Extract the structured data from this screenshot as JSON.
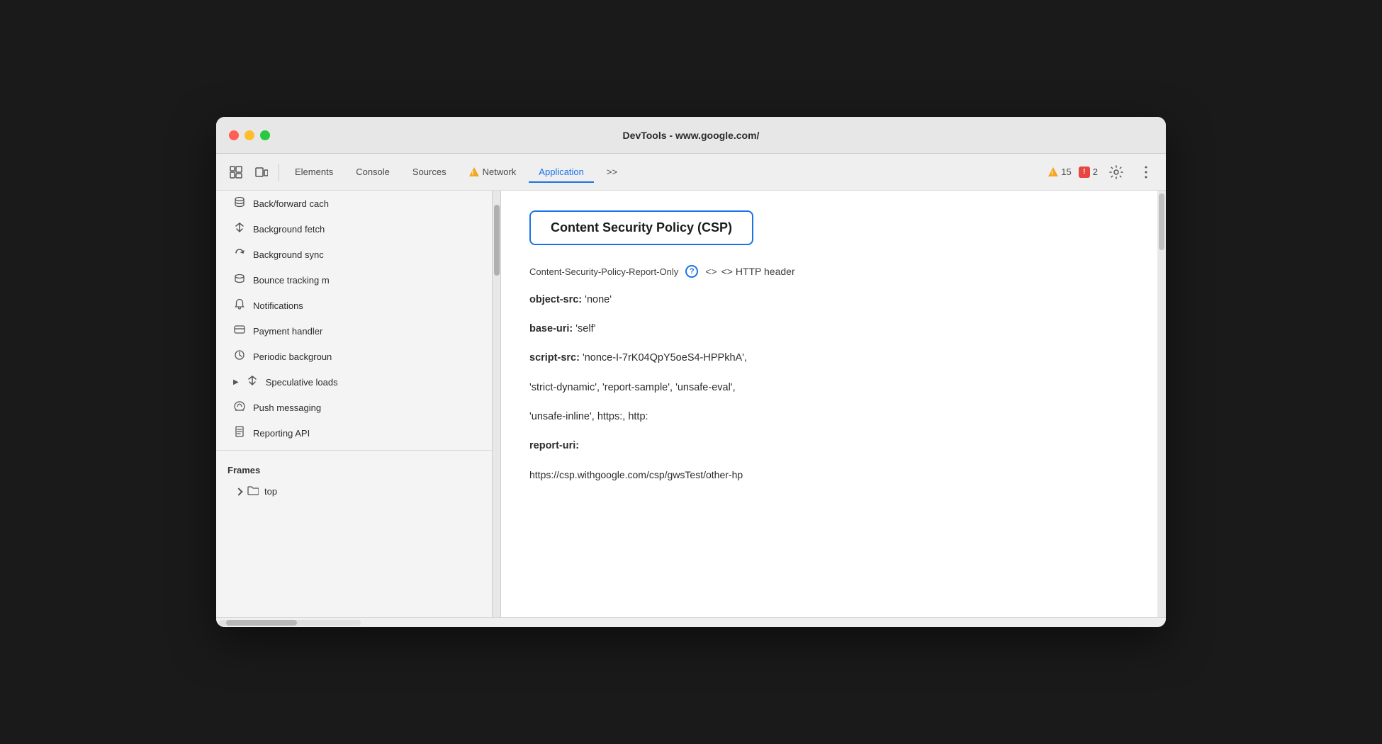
{
  "window": {
    "title": "DevTools - www.google.com/"
  },
  "toolbar": {
    "tabs": [
      {
        "id": "elements",
        "label": "Elements",
        "active": false
      },
      {
        "id": "console",
        "label": "Console",
        "active": false
      },
      {
        "id": "sources",
        "label": "Sources",
        "active": false
      },
      {
        "id": "network",
        "label": "Network",
        "active": false,
        "warning": true
      },
      {
        "id": "application",
        "label": "Application",
        "active": true
      }
    ],
    "more_tabs_label": ">>",
    "warnings_count": "15",
    "errors_count": "2"
  },
  "sidebar": {
    "items": [
      {
        "id": "back-forward-cache",
        "label": "Back/forward cach",
        "icon": "🗄"
      },
      {
        "id": "background-fetch",
        "label": "Background fetch",
        "icon": "⇅"
      },
      {
        "id": "background-sync",
        "label": "Background sync",
        "icon": "↺"
      },
      {
        "id": "bounce-tracking",
        "label": "Bounce tracking m",
        "icon": "🗄"
      },
      {
        "id": "notifications",
        "label": "Notifications",
        "icon": "🔔"
      },
      {
        "id": "payment-handler",
        "label": "Payment handler",
        "icon": "💳"
      },
      {
        "id": "periodic-background",
        "label": "Periodic backgroun",
        "icon": "⏱"
      },
      {
        "id": "speculative-loads",
        "label": "Speculative loads",
        "icon": "⇅",
        "has_arrow": true
      },
      {
        "id": "push-messaging",
        "label": "Push messaging",
        "icon": "☁"
      },
      {
        "id": "reporting-api",
        "label": "Reporting API",
        "icon": "📄"
      }
    ],
    "frames_section": {
      "header": "Frames",
      "items": [
        {
          "id": "top",
          "label": "top",
          "icon": "🗂"
        }
      ]
    }
  },
  "main": {
    "csp_title": "Content Security Policy (CSP)",
    "source_label": "Content-Security-Policy-Report-Only",
    "http_header_label": "<> HTTP header",
    "directives": [
      {
        "id": "object-src",
        "key": "object-src:",
        "value": " 'none'"
      },
      {
        "id": "base-uri",
        "key": "base-uri:",
        "value": " 'self'"
      },
      {
        "id": "script-src",
        "key": "script-src:",
        "value": " 'nonce-I-7rK04QpY5oeS4-HPPkhA',"
      },
      {
        "id": "script-src-cont",
        "key": "",
        "value": "'strict-dynamic', 'report-sample', 'unsafe-eval',"
      },
      {
        "id": "script-src-cont2",
        "key": "",
        "value": "'unsafe-inline', https:, http:"
      },
      {
        "id": "report-uri",
        "key": "report-uri:",
        "value": ""
      },
      {
        "id": "report-uri-url",
        "key": "",
        "value": "https://csp.withgoogle.com/csp/gwsTest/other-hp"
      }
    ]
  }
}
